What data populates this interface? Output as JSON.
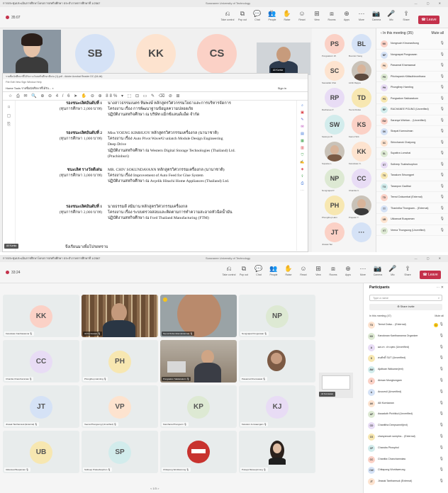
{
  "w1": {
    "title": "การประชุมประเมินการศึกษาโครงการสหกิจศึกษา ประจำภาคการศึกษาที่ 1/2567",
    "center": "Suranaree University of Technology",
    "timer": "35:07",
    "toolbar": [
      "Take control",
      "Pop out",
      "Chat",
      "People",
      "Raise",
      "React",
      "View",
      "Rooms",
      "Apps",
      "More",
      "Camera",
      "Mic",
      "Share"
    ],
    "leave": "Leave",
    "people_count": "34",
    "stage_tiles": [
      "SB",
      "KK",
      "CS"
    ],
    "speaker_chip": "Ali Kurnia",
    "doc": {
      "title": "รายชื่อนักศึกษาที่ได้รับรางวัลสหกิจศึกษาดีเด่น (1).pdf - Adobe Acrobat Reader DC (64-bit)",
      "menu": "File  Edit  View  Sign  Window  Help",
      "nav": "Home   Tools   รายชื่อนักศึกษาที่ได้รับ... ×",
      "sign_in": "Sign in",
      "tools": "☆ ⎙ ✉ 🔍   ⊕ ⊖  4 / 6   ➤ ✋ ⊖ ⊕  88% ▾  ⬚ ⊡ ▭ ✎ ⌫ ⊘ ⊞",
      "entries": [
        {
          "award": "รองชนะเลิศอันดับที่ 1",
          "prize": "(ทุนการศึกษา 2,000 บาท)",
          "lines": [
            "นางสาวธรรมเนตร ทิมพงษ์     หลักสูตรวิศวกรรมโยธาและการบริหารจัดการ",
            "โครงงาน เรื่อง การพัฒนาฐานข้อมูลความปลอดภัย",
            "ปฏิบัติงานสหกิจศึกษา ณ บริษัท แม็กซ์แลนด์แอ็ด จำกัด"
          ]
        },
        {
          "award": "รองชนะเลิศอันดับที่ 2",
          "prize": "(ทุนการศึกษา 1,000 บาท)",
          "lines": [
            "Miss YOENG KIMHUOY     หลักสูตรวิศวกรรมเครื่องกล (นานาชาติ)",
            "โครงงาน เรื่อง Auto Pivot Wave#2 unlatch Module Design Engineering",
            "Deep Drive",
            "ปฏิบัติงานสหกิจศึกษา ณ Western Digital Storage Technologies (Thailand) Ltd.",
            "(Prachinburi)"
          ]
        },
        {
          "award": "ชนะเลิศ รางวัลดีเด่น",
          "prize": "(ทุนการศึกษา 3,000 บาท)",
          "lines": [
            "MR. CHIV SOKUNDAVANN     หลักสูตรวิศวกรรมเครื่องกล (นานาชาติ)",
            "โครงงาน เรื่อง Improvement of Auto Feed for Glue System",
            "ปฏิบัติงานสหกิจศึกษา ณ Arçelik Hitachi Home Appliances (Thailand) Ltd."
          ]
        },
        {
          "award": "รองชนะเลิศอันดับที่ 1",
          "prize": "(ทุนการศึกษา 2,000 บาท)",
          "lines": [
            "นายธรรมดี สมิมาน          หลักสูตรวิศวกรรมเครื่องกล",
            "โครงงาน เรื่อง ระบบตรวจสอบและติดตามการทำความสะอาดหัวฉีดน้ำมัน",
            "ปฏิบัติงานสหกิจศึกษา ณ Ford Thailand Manufacturing (FTM)"
          ]
        }
      ],
      "footer": "จึงเรียนมาเพื่อโปรดทราบ"
    },
    "presenter_chip": "Ali Kurnia",
    "grid": [
      {
        "i": "PS",
        "n": "Pongsakorn W."
      },
      {
        "i": "BL",
        "n": "Boonlert Sang"
      },
      {
        "i": "SC",
        "n": "Saowalak Chai"
      },
      {
        "i": "",
        "n": "Likhit Rappa"
      },
      {
        "i": "RP",
        "n": "Rachanee P."
      },
      {
        "i": "TD",
        "n": "Teerut Dolsa"
      },
      {
        "i": "SW",
        "n": "Saranya W."
      },
      {
        "i": "KS",
        "n": "Kamol Sirit"
      },
      {
        "i": "",
        "n": "Supatsa L."
      },
      {
        "i": "KK",
        "n": "Kanokwan K."
      },
      {
        "i": "NP",
        "n": "Nongnapat P."
      },
      {
        "i": "CC",
        "n": "Chanitta C."
      },
      {
        "i": "PH",
        "n": "Phongthep Harn"
      },
      {
        "i": "",
        "n": "Prapasri T."
      },
      {
        "i": "JT",
        "n": "Jirawat Tan"
      },
      {
        "i": "···",
        "n": ""
      }
    ],
    "panel_head": "In this meeting (35)",
    "mute_all": "Mute all",
    "panel": [
      {
        "i": "NK",
        "n": "Nongnuch Khrueasthong"
      },
      {
        "i": "NP",
        "n": "Nongnapat Pongsuwan"
      },
      {
        "i": "PK",
        "n": "Pawanrat Khamsawat"
      },
      {
        "i": "PH",
        "n": "Phichayanin Kittisuthinonthana"
      },
      {
        "i": "PH",
        "n": "Phongthep Harnting"
      },
      {
        "i": "PS",
        "n": "Pongsakon Sakkarakorn"
      },
      {
        "i": "RP",
        "n": "RACHANEE POUNG (Unverified)"
      },
      {
        "i": "SW",
        "n": "Saranya Wichian... (Unverified)"
      },
      {
        "i": "SK",
        "n": "Sirapat Kamnoiman"
      },
      {
        "i": "SC",
        "n": "Sirinchanok Chaiyong"
      },
      {
        "i": "SL",
        "n": "Supattra Lomchai"
      },
      {
        "i": "ST",
        "n": "Sutheep Tuabsrisophon"
      },
      {
        "i": "TS",
        "n": "Tanakorn Srisongpet"
      },
      {
        "i": "TG",
        "n": "Taranpon Gadthai"
      },
      {
        "i": "TD",
        "n": "Teerut Dolsombat (External)"
      },
      {
        "i": "TT",
        "n": "Thanintha Thongsam... (External)"
      },
      {
        "i": "UB",
        "n": "Ukkanuat Buapaman"
      },
      {
        "i": "VT",
        "n": "Veena Thongsong (Unverified)"
      }
    ]
  },
  "w2": {
    "title": "การประชุมประเมินการศึกษาโครงการสหกิจศึกษา ประจำภาคการศึกษาที่ 1/2567",
    "center": "Suranaree University of Technology",
    "timer": "33:24",
    "toolbar": [
      "Take control",
      "Pop out",
      "Chat",
      "People",
      "Raise",
      "React",
      "View",
      "Rooms",
      "Apps",
      "More",
      "Camera",
      "Mic",
      "Share"
    ],
    "leave": "Leave",
    "tiles": [
      {
        "i": "KK",
        "n": "Kanokwan Kanthawanna",
        "v": ""
      },
      {
        "i": "",
        "n": "Ali Kurniawan",
        "v": "shelf"
      },
      {
        "i": "",
        "n": "Teerut Dolsombat (External)",
        "v": "bald"
      },
      {
        "i": "NP",
        "n": "Nongnapat Pongsuwan",
        "v": ""
      },
      {
        "i": "CC",
        "n": "Chanitta Chanchamniaw",
        "v": ""
      },
      {
        "i": "PH",
        "n": "Phongthep Harnting",
        "v": ""
      },
      {
        "i": "",
        "n": "Pongsakon Sakkarakorn",
        "v": "room"
      },
      {
        "i": "",
        "n": "Pawanrat Khamsawat",
        "v": "small"
      },
      {
        "i": "JT",
        "n": "Jirasak Tanthamsuk (External)",
        "v": ""
      },
      {
        "i": "VP",
        "n": "Veena Phengsong (Unverified)",
        "v": ""
      },
      {
        "i": "KP",
        "n": "Kanchana Phongsorn",
        "v": ""
      },
      {
        "i": "KJ",
        "n": "Kanokon Jomsaengam",
        "v": ""
      },
      {
        "i": "UB",
        "n": "Ukkanuat Buapaman",
        "v": ""
      },
      {
        "i": "SP",
        "n": "Sutheep Pratuabsophon",
        "v": ""
      },
      {
        "i": "",
        "n": "Chitapong Worldwerung",
        "v": "logo"
      },
      {
        "i": "",
        "n": "Pusaya Maneepimong",
        "v": "woman"
      }
    ],
    "pager": "< 1/3 >",
    "mini_chip": "Ali Kurniawan",
    "participants_title": "Participants",
    "search_placeholder": "Type a name",
    "share_invite": "Share invite",
    "in_meeting": "In this meeting (47)",
    "mute_all": "Mute all",
    "panel": [
      {
        "i": "TD",
        "n": "Teerut Dolso... (External)",
        "badge": "1"
      },
      {
        "i": "KK",
        "n": "Kanokwan Kanthawanna Organizer"
      },
      {
        "i": "A",
        "n": "ผศ.ดร. ประยุทธ (Unverified)"
      },
      {
        "i": "S",
        "n": "สมศักดิ์ SUT (Unverified)"
      },
      {
        "i": "AW",
        "n": "Ajaltuan Waluwan(ext)"
      },
      {
        "i": "A",
        "n": "Airwan Mungkongam"
      },
      {
        "i": "A",
        "n": "Anocesil (Unverified)"
      },
      {
        "i": "AK",
        "n": "Alli Kurniawan"
      },
      {
        "i": "AP",
        "n": "Assaduth Pichitkul (Unverified)"
      },
      {
        "i": "CD",
        "n": "Chanittha Deepsamrit(ext)"
      },
      {
        "i": "CS",
        "n": "chanyanuch sompha... (External)"
      },
      {
        "i": "CP",
        "n": "Chandra Phosphol"
      },
      {
        "i": "CC",
        "n": "Chanitta Chanchamniaw"
      },
      {
        "i": "CW",
        "n": "Chitapong Worldwerung"
      },
      {
        "i": "JT",
        "n": "Jirasak Tanthamsuk (External)"
      }
    ]
  },
  "colors": {
    "accent": "#5b5fc7",
    "leave": "#c4314b",
    "avatar_palette": [
      "#fbd1c6",
      "#d5e2f6",
      "#fde3cf",
      "#dde9d3",
      "#e8dcf5",
      "#f7e7b1",
      "#d2ecec"
    ]
  }
}
